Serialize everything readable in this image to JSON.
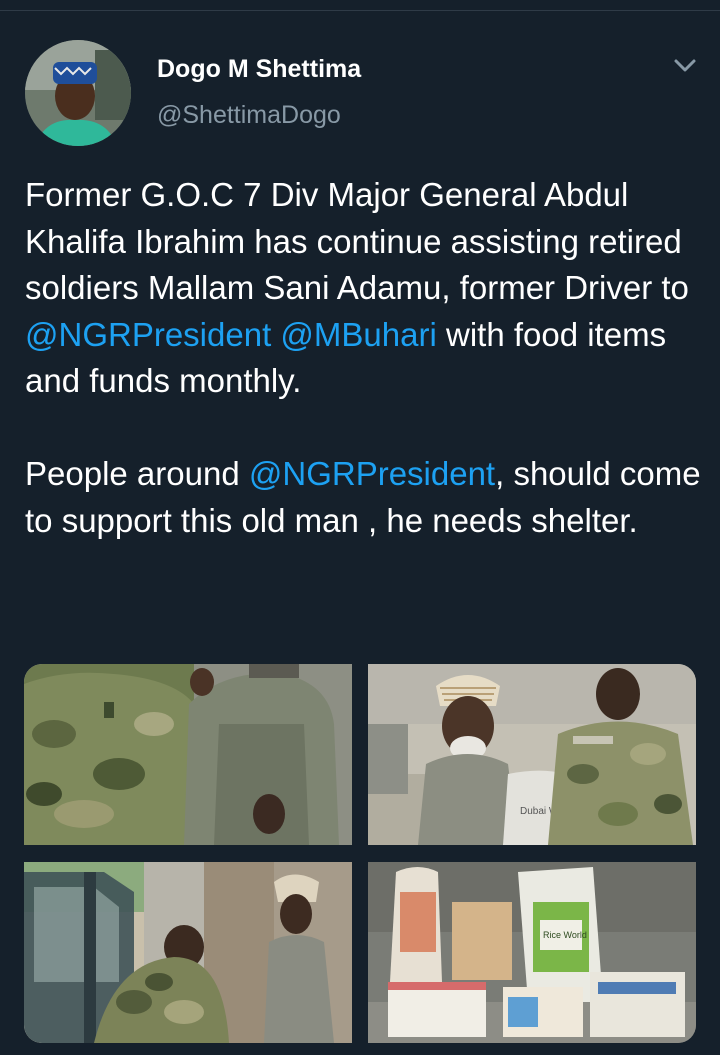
{
  "user": {
    "display_name": "Dogo M Shettima",
    "handle": "@ShettimaDogo",
    "avatar_icon": "profile-photo"
  },
  "menu": {
    "icon": "chevron-down-icon"
  },
  "tweet": {
    "p1": {
      "t1": "Former G.O.C 7 Div Major General Abdul Khalifa Ibrahim has continue assisting retired soldiers Mallam Sani Adamu, former Driver to ",
      "m1": "@NGRPresident",
      "t2": " ",
      "m2": "@MBuhari",
      "t3": " with food items and funds monthly."
    },
    "p2": {
      "t1": "People around ",
      "m1": "@NGRPresident",
      "t2": ", should come to support this old man , he needs shelter."
    }
  },
  "photos": {
    "photo2_sack_text": "Dubai World",
    "photo4_sack_label": "Rice World"
  },
  "colors": {
    "background": "#15202b",
    "text": "#ffffff",
    "secondary": "#8899a6",
    "link": "#1da1f2"
  }
}
